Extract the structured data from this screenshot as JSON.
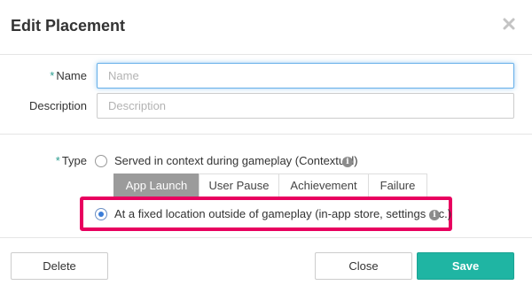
{
  "modal": {
    "title": "Edit Placement"
  },
  "form": {
    "name": {
      "required_mark": "*",
      "label": "Name",
      "value": "",
      "placeholder": "Name"
    },
    "description": {
      "label": "Description",
      "value": "",
      "placeholder": "Description"
    },
    "type": {
      "required_mark": "*",
      "label": "Type",
      "options": [
        {
          "label": "Served in context during gameplay (Contextual)",
          "checked": false
        },
        {
          "label": "At a fixed location outside of gameplay (in-app store, settings etc.)",
          "checked": true
        }
      ],
      "tabs": [
        {
          "label": "App Launch",
          "active": true
        },
        {
          "label": "User Pause",
          "active": false
        },
        {
          "label": "Achievement",
          "active": false
        },
        {
          "label": "Failure",
          "active": false
        }
      ]
    }
  },
  "footer": {
    "delete_label": "Delete",
    "close_label": "Close",
    "save_label": "Save"
  },
  "colors": {
    "accent": "#1fb5a3",
    "highlight": "#e8005f",
    "tab_active": "#9b9b9b",
    "focus": "#66afe9"
  },
  "icons": {
    "close": "close-icon",
    "info": "info-icon"
  }
}
